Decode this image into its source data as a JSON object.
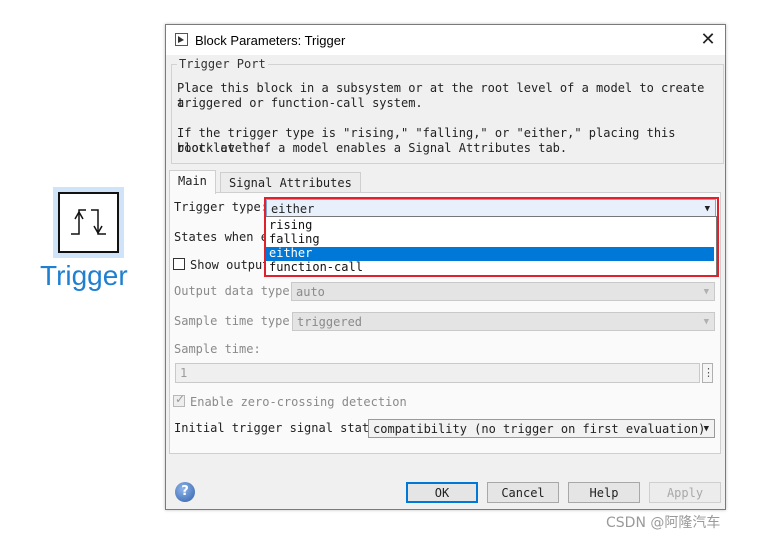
{
  "block": {
    "name": "Trigger",
    "icon": "trigger-block-icon",
    "accent": "#1f7fd1"
  },
  "dialog": {
    "title": "Block Parameters: Trigger",
    "group_title": "Trigger Port",
    "description_1a": "Place this block in a subsystem or at the root level of a model to create a",
    "description_1b": "triggered or function-call system.",
    "description_2a": "If the trigger type is \"rising,\" \"falling,\" or \"either,\" placing this block at the",
    "description_2b": "root level of a model enables a Signal Attributes tab."
  },
  "tabs": [
    {
      "label": "Main",
      "active": true
    },
    {
      "label": "Signal Attributes",
      "active": false
    }
  ],
  "params": {
    "trigger_type_label": "Trigger type:",
    "trigger_type_value": "either",
    "trigger_type_options": [
      "rising",
      "falling",
      "either",
      "function-call"
    ],
    "states_label": "States when en",
    "show_output_label": "Show output",
    "output_data_type_label": "Output data type:",
    "output_data_type_value": "auto",
    "sample_time_type_label": "Sample time type:",
    "sample_time_type_value": "triggered",
    "sample_time_label": "Sample time:",
    "sample_time_value": "1",
    "sample_time_button": "⋮",
    "zero_crossing_label": "Enable zero-crossing detection",
    "initial_state_label": "Initial trigger signal state:",
    "initial_state_value": "compatibility (no trigger on first evaluation)"
  },
  "buttons": {
    "ok": "OK",
    "cancel": "Cancel",
    "help": "Help",
    "apply": "Apply",
    "help_icon": "?"
  },
  "close_glyph": "✕",
  "dropdown_arrow": "▼",
  "watermark": "CSDN @阿隆汽车",
  "colors": {
    "selection": "#0078d7",
    "annotation_box": "#e0202a"
  }
}
